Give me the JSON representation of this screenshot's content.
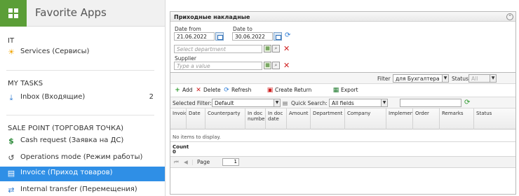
{
  "app": {
    "title": "Favorite Apps"
  },
  "sidebar": {
    "sections": [
      {
        "label": "IT"
      },
      {
        "label": "MY TASKS"
      },
      {
        "label": "SALE POINT (ТОРГОВАЯ ТОЧКА)"
      }
    ],
    "items": [
      {
        "label": "Services (Сервисы)",
        "icon": "sun-icon"
      },
      {
        "label": "Inbox (Входящие)",
        "icon": "download-icon",
        "count": "2"
      },
      {
        "label": "Cash request (Заявка на ДС)",
        "icon": "dollar-icon"
      },
      {
        "label": "Operations mode (Режим работы)",
        "icon": "history-icon"
      },
      {
        "label": "Invoice (Приход товаров)",
        "icon": "invoice-icon",
        "active": true
      },
      {
        "label": "Internal transfer (Перемещения)",
        "icon": "transfer-icon"
      }
    ]
  },
  "panel": {
    "title": "Приходные накладные",
    "date_from_label": "Date from",
    "date_from_value": "21.06.2022",
    "date_to_label": "Date to",
    "date_to_value": "30.06.2022",
    "department_placeholder": "Select department",
    "supplier_label": "Supplier",
    "supplier_placeholder": "Type a value"
  },
  "toolbar": {
    "filter_label": "Filter",
    "filter_value": "для Бухгалтера",
    "status_label": "Status",
    "status_value": "All",
    "actions": {
      "add": "Add",
      "delete": "Delete",
      "refresh": "Refresh",
      "create_return": "Create Return",
      "export": "Export"
    },
    "selected_filter_label": "Selected Filter:",
    "selected_filter_value": "Default",
    "quick_search_label": "Quick Search:",
    "quick_search_value": "All fields"
  },
  "grid": {
    "columns": [
      "Invoice",
      "Date",
      "Counterparty",
      "In doc number",
      "In doc date",
      "Amount",
      "Department",
      "Company",
      "Implementer",
      "Order",
      "Remarks",
      "Status"
    ],
    "empty_text": "No items to display.",
    "summary_label": "Count 0",
    "pager": {
      "page_label": "Page",
      "page_value": "1"
    }
  },
  "colors": {
    "accent": "#2f8fe6",
    "logo": "#5b9e37",
    "delete": "#d02020"
  }
}
